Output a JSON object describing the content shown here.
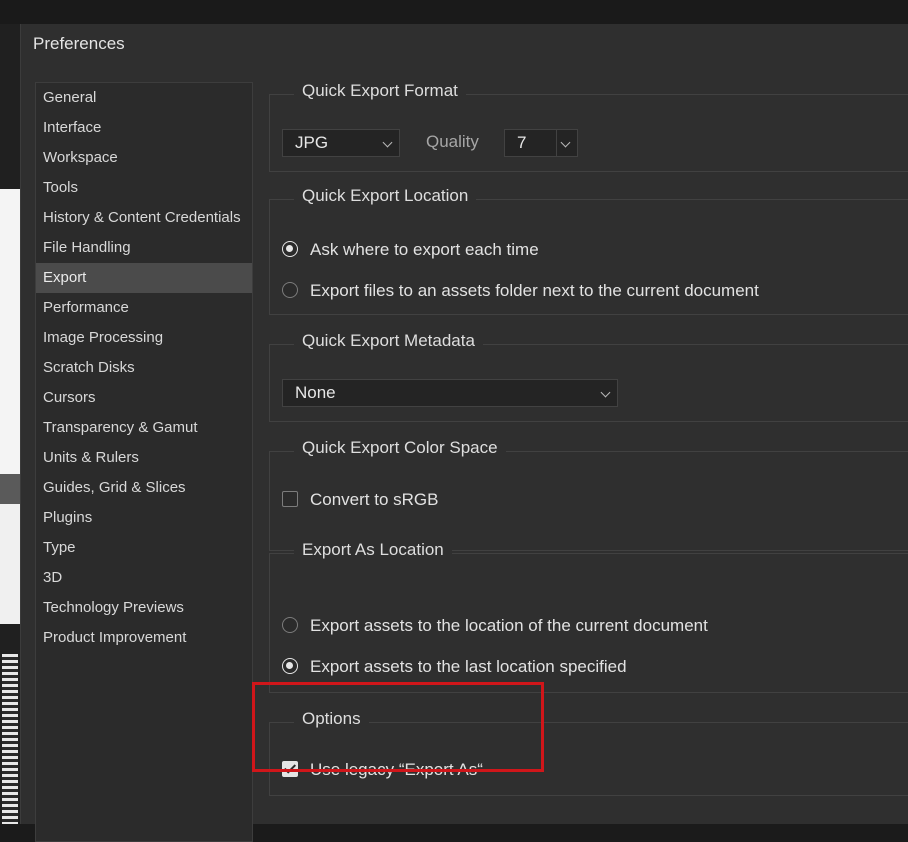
{
  "dialog": {
    "title": "Preferences"
  },
  "sidebar": {
    "items": [
      {
        "label": "General"
      },
      {
        "label": "Interface"
      },
      {
        "label": "Workspace"
      },
      {
        "label": "Tools"
      },
      {
        "label": "History & Content Credentials"
      },
      {
        "label": "File Handling"
      },
      {
        "label": "Export",
        "active": true
      },
      {
        "label": "Performance"
      },
      {
        "label": "Image Processing"
      },
      {
        "label": "Scratch Disks"
      },
      {
        "label": "Cursors"
      },
      {
        "label": "Transparency & Gamut"
      },
      {
        "label": "Units & Rulers"
      },
      {
        "label": "Guides, Grid & Slices"
      },
      {
        "label": "Plugins"
      },
      {
        "label": "Type"
      },
      {
        "label": "3D"
      },
      {
        "label": "Technology Previews"
      },
      {
        "label": "Product Improvement"
      }
    ]
  },
  "quick_export_format": {
    "title": "Quick Export Format",
    "format_value": "JPG",
    "quality_label": "Quality",
    "quality_value": "7"
  },
  "quick_export_location": {
    "title": "Quick Export Location",
    "options": [
      {
        "label": "Ask where to export each time",
        "selected": true
      },
      {
        "label": "Export files to an assets folder next to the current document",
        "selected": false
      }
    ]
  },
  "quick_export_metadata": {
    "title": "Quick Export Metadata",
    "value": "None"
  },
  "quick_export_color_space": {
    "title": "Quick Export Color Space",
    "convert_label": "Convert to sRGB",
    "convert_checked": false
  },
  "export_as_location": {
    "title": "Export As Location",
    "options": [
      {
        "label": "Export assets to the location of the current document",
        "selected": false
      },
      {
        "label": "Export assets to the last location specified",
        "selected": true
      }
    ]
  },
  "options": {
    "title": "Options",
    "legacy_label": "Use legacy “Export As“",
    "legacy_checked": true
  },
  "colors": {
    "highlight": "#d0161a",
    "dialog_bg": "#2f2f2f",
    "active_item_bg": "#4b4b4b"
  }
}
